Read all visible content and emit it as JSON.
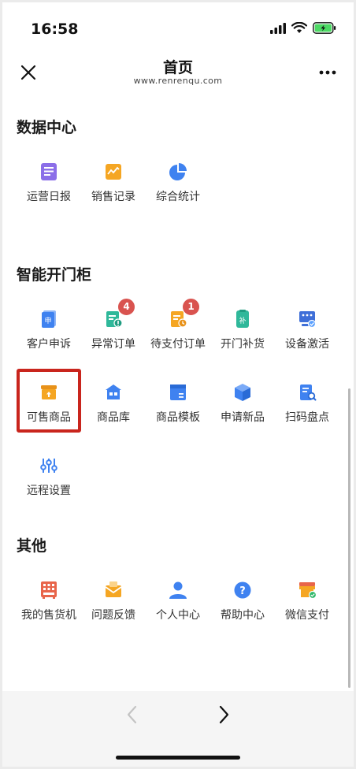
{
  "status_bar": {
    "time": "16:58"
  },
  "header": {
    "title": "首页",
    "subtitle": "www.renrenqu.com"
  },
  "sections": {
    "data_center": {
      "title": "数据中心",
      "items": [
        {
          "label": "运营日报",
          "icon": "report-icon",
          "color": "#8b6ee8"
        },
        {
          "label": "销售记录",
          "icon": "sales-record-icon",
          "color": "#f5a623"
        },
        {
          "label": "综合统计",
          "icon": "pie-chart-icon",
          "color": "#3f82f0"
        }
      ]
    },
    "smart_cabinet": {
      "title": "智能开门柜",
      "items": [
        {
          "label": "客户申诉",
          "icon": "complaint-icon",
          "color": "#3f82f0",
          "badge": ""
        },
        {
          "label": "异常订单",
          "icon": "abnormal-order-icon",
          "color": "#2fb89a",
          "badge": "4"
        },
        {
          "label": "待支付订单",
          "icon": "pending-payment-icon",
          "color": "#f5a623",
          "badge": "1"
        },
        {
          "label": "开门补货",
          "icon": "restock-icon",
          "color": "#2fb89a",
          "badge": ""
        },
        {
          "label": "设备激活",
          "icon": "device-activate-icon",
          "color": "#3f6fd8",
          "badge": ""
        },
        {
          "label": "可售商品",
          "icon": "sellable-goods-icon",
          "color": "#f5a623",
          "badge": ""
        },
        {
          "label": "商品库",
          "icon": "goods-library-icon",
          "color": "#3f82f0",
          "badge": ""
        },
        {
          "label": "商品模板",
          "icon": "goods-template-icon",
          "color": "#3f82f0",
          "badge": ""
        },
        {
          "label": "申请新品",
          "icon": "new-goods-icon",
          "color": "#3f82f0",
          "badge": ""
        },
        {
          "label": "扫码盘点",
          "icon": "scan-inventory-icon",
          "color": "#3f82f0",
          "badge": ""
        },
        {
          "label": "远程设置",
          "icon": "remote-settings-icon",
          "color": "#3f82f0",
          "badge": ""
        }
      ]
    },
    "other": {
      "title": "其他",
      "items": [
        {
          "label": "我的售货机",
          "icon": "vending-machine-icon",
          "color": "#e8654a"
        },
        {
          "label": "问题反馈",
          "icon": "feedback-icon",
          "color": "#f5a623"
        },
        {
          "label": "个人中心",
          "icon": "user-icon",
          "color": "#3f82f0"
        },
        {
          "label": "帮助中心",
          "icon": "help-icon",
          "color": "#3f82f0"
        },
        {
          "label": "微信支付",
          "icon": "wechat-pay-icon",
          "color": "#f5a623"
        }
      ]
    }
  }
}
